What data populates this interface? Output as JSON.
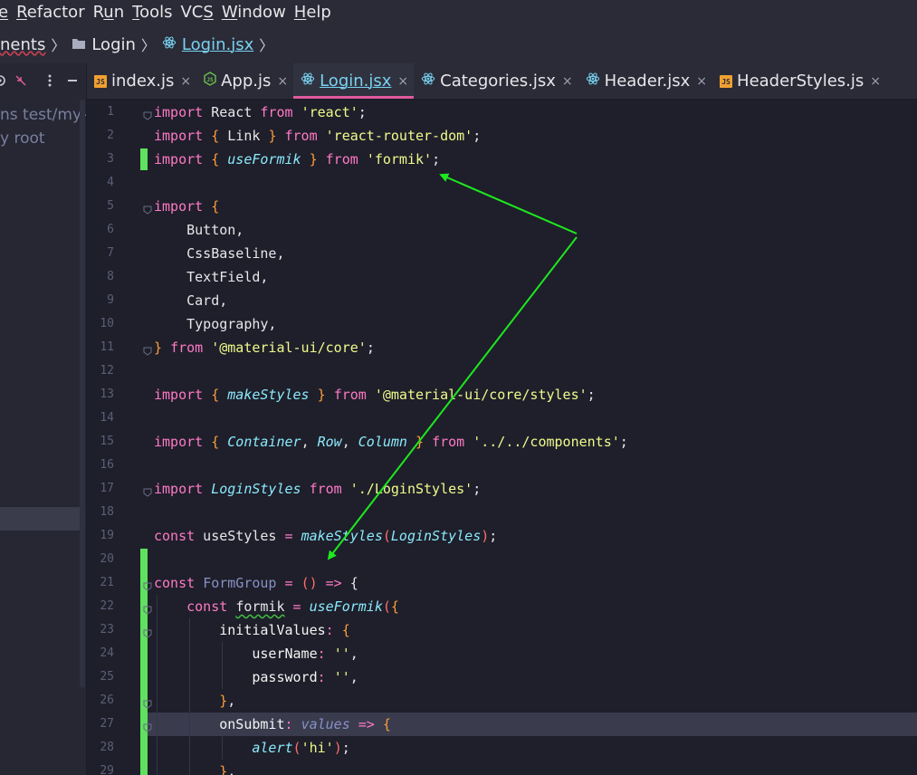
{
  "menubar": {
    "items": [
      {
        "label": "e",
        "mnemonic_index": 0
      },
      {
        "label": "Refactor",
        "mnemonic_index": 0
      },
      {
        "label": "Run",
        "mnemonic_index": 1
      },
      {
        "label": "Tools",
        "mnemonic_index": 0
      },
      {
        "label": "VCS",
        "mnemonic_index": 2
      },
      {
        "label": "Window",
        "mnemonic_index": 0
      },
      {
        "label": "Help",
        "mnemonic_index": 0
      }
    ]
  },
  "breadcrumb": {
    "items": [
      {
        "label": "nents",
        "icon": ""
      },
      {
        "label": "Login",
        "icon": "folder-icon"
      },
      {
        "label": "Login.jsx",
        "icon": "react-icon"
      }
    ]
  },
  "project_panel": {
    "tree": [
      {
        "label": "ns test/my-"
      },
      {
        "label": "y root"
      }
    ]
  },
  "tabs": [
    {
      "label": "index.js",
      "icon": "js-icon",
      "active": false
    },
    {
      "label": "App.js",
      "icon": "node-icon",
      "active": false
    },
    {
      "label": "Login.jsx",
      "icon": "react-icon",
      "active": true
    },
    {
      "label": "Categories.jsx",
      "icon": "react-icon",
      "active": false
    },
    {
      "label": "Header.jsx",
      "icon": "react-icon",
      "active": false
    },
    {
      "label": "HeaderStyles.js",
      "icon": "js-icon",
      "active": false
    }
  ],
  "editor": {
    "current_line": 27,
    "lines": [
      {
        "n": 1,
        "tokens": [
          [
            "kw",
            "import"
          ],
          [
            "punc",
            " React "
          ],
          [
            "kw",
            "from"
          ],
          [
            "punc",
            " "
          ],
          [
            "str",
            "'react'"
          ],
          [
            "punc",
            ";"
          ]
        ]
      },
      {
        "n": 2,
        "tokens": [
          [
            "kw",
            "import"
          ],
          [
            "punc",
            " "
          ],
          [
            "brk",
            "{"
          ],
          [
            "punc",
            " Link "
          ],
          [
            "brk",
            "}"
          ],
          [
            "punc",
            " "
          ],
          [
            "kw",
            "from"
          ],
          [
            "punc",
            " "
          ],
          [
            "str",
            "'react-router-dom'"
          ],
          [
            "punc",
            ";"
          ]
        ]
      },
      {
        "n": 3,
        "tokens": [
          [
            "kw",
            "import"
          ],
          [
            "punc",
            " "
          ],
          [
            "brk",
            "{"
          ],
          [
            "punc",
            " "
          ],
          [
            "ital",
            "useFormik"
          ],
          [
            "punc",
            " "
          ],
          [
            "brk",
            "}"
          ],
          [
            "punc",
            " "
          ],
          [
            "kw",
            "from"
          ],
          [
            "punc",
            " "
          ],
          [
            "str",
            "'formik'"
          ],
          [
            "punc",
            ";"
          ]
        ]
      },
      {
        "n": 4,
        "tokens": []
      },
      {
        "n": 5,
        "tokens": [
          [
            "kw",
            "import"
          ],
          [
            "punc",
            " "
          ],
          [
            "brk",
            "{"
          ]
        ]
      },
      {
        "n": 6,
        "tokens": [
          [
            "punc",
            "    Button,"
          ]
        ]
      },
      {
        "n": 7,
        "tokens": [
          [
            "punc",
            "    CssBaseline,"
          ]
        ]
      },
      {
        "n": 8,
        "tokens": [
          [
            "punc",
            "    TextField,"
          ]
        ]
      },
      {
        "n": 9,
        "tokens": [
          [
            "punc",
            "    Card,"
          ]
        ]
      },
      {
        "n": 10,
        "tokens": [
          [
            "punc",
            "    Typography,"
          ]
        ]
      },
      {
        "n": 11,
        "tokens": [
          [
            "brk",
            "}"
          ],
          [
            "punc",
            " "
          ],
          [
            "kw",
            "from"
          ],
          [
            "punc",
            " "
          ],
          [
            "str",
            "'@material-ui/core'"
          ],
          [
            "punc",
            ";"
          ]
        ]
      },
      {
        "n": 12,
        "tokens": []
      },
      {
        "n": 13,
        "tokens": [
          [
            "kw",
            "import"
          ],
          [
            "punc",
            " "
          ],
          [
            "brk",
            "{"
          ],
          [
            "punc",
            " "
          ],
          [
            "ital",
            "makeStyles"
          ],
          [
            "punc",
            " "
          ],
          [
            "brk",
            "}"
          ],
          [
            "punc",
            " "
          ],
          [
            "kw",
            "from"
          ],
          [
            "punc",
            " "
          ],
          [
            "str",
            "'@material-ui/core/styles'"
          ],
          [
            "punc",
            ";"
          ]
        ]
      },
      {
        "n": 14,
        "tokens": []
      },
      {
        "n": 15,
        "tokens": [
          [
            "kw",
            "import"
          ],
          [
            "punc",
            " "
          ],
          [
            "brk",
            "{"
          ],
          [
            "punc",
            " "
          ],
          [
            "ital",
            "Container"
          ],
          [
            "punc",
            ", "
          ],
          [
            "ital",
            "Row"
          ],
          [
            "punc",
            ", "
          ],
          [
            "ital",
            "Column"
          ],
          [
            "punc",
            " "
          ],
          [
            "brk",
            "}"
          ],
          [
            "punc",
            " "
          ],
          [
            "kw",
            "from"
          ],
          [
            "punc",
            " "
          ],
          [
            "str",
            "'../../components'"
          ],
          [
            "punc",
            ";"
          ]
        ]
      },
      {
        "n": 16,
        "tokens": []
      },
      {
        "n": 17,
        "tokens": [
          [
            "kw",
            "import"
          ],
          [
            "punc",
            " "
          ],
          [
            "ital",
            "LoginStyles"
          ],
          [
            "punc",
            " "
          ],
          [
            "kw",
            "from"
          ],
          [
            "punc",
            " "
          ],
          [
            "str",
            "'./LoginStyles'"
          ],
          [
            "punc",
            ";"
          ]
        ]
      },
      {
        "n": 18,
        "tokens": []
      },
      {
        "n": 19,
        "tokens": [
          [
            "kw",
            "const"
          ],
          [
            "punc",
            " useStyles "
          ],
          [
            "kw",
            "="
          ],
          [
            "punc",
            " "
          ],
          [
            "ital",
            "makeStyles"
          ],
          [
            "paren",
            "("
          ],
          [
            "ital",
            "LoginStyles"
          ],
          [
            "paren",
            ")"
          ],
          [
            "punc",
            ";"
          ]
        ]
      },
      {
        "n": 20,
        "tokens": []
      },
      {
        "n": 21,
        "tokens": [
          [
            "kw",
            "const"
          ],
          [
            "punc",
            " "
          ],
          [
            "fn",
            "FormGroup"
          ],
          [
            "punc",
            " "
          ],
          [
            "kw",
            "="
          ],
          [
            "punc",
            " "
          ],
          [
            "paren",
            "()"
          ],
          [
            "punc",
            " "
          ],
          [
            "kw",
            "=>"
          ],
          [
            "punc",
            " {"
          ]
        ]
      },
      {
        "n": 22,
        "tokens": [
          [
            "punc",
            "    "
          ],
          [
            "kw",
            "const"
          ],
          [
            "punc",
            " "
          ],
          [
            "squig",
            "formik"
          ],
          [
            "punc",
            " "
          ],
          [
            "kw",
            "="
          ],
          [
            "punc",
            " "
          ],
          [
            "ital",
            "useFormik"
          ],
          [
            "paren",
            "("
          ],
          [
            "brk",
            "{"
          ]
        ]
      },
      {
        "n": 23,
        "tokens": [
          [
            "punc",
            "        "
          ],
          [
            "prop",
            "initialValues"
          ],
          [
            "kw",
            ":"
          ],
          [
            "punc",
            " "
          ],
          [
            "brk",
            "{"
          ]
        ]
      },
      {
        "n": 24,
        "tokens": [
          [
            "punc",
            "            "
          ],
          [
            "prop",
            "userName"
          ],
          [
            "kw",
            ":"
          ],
          [
            "punc",
            " "
          ],
          [
            "str",
            "''"
          ],
          [
            "punc",
            ","
          ]
        ]
      },
      {
        "n": 25,
        "tokens": [
          [
            "punc",
            "            "
          ],
          [
            "prop",
            "password"
          ],
          [
            "kw",
            ":"
          ],
          [
            "punc",
            " "
          ],
          [
            "str",
            "''"
          ],
          [
            "punc",
            ","
          ]
        ]
      },
      {
        "n": 26,
        "tokens": [
          [
            "punc",
            "        "
          ],
          [
            "brk",
            "}"
          ],
          [
            "punc",
            ","
          ]
        ]
      },
      {
        "n": 27,
        "tokens": [
          [
            "punc",
            "        "
          ],
          [
            "prop",
            "onSubmit"
          ],
          [
            "kw",
            ":"
          ],
          [
            "punc",
            " "
          ],
          [
            "prm",
            "values"
          ],
          [
            "punc",
            " "
          ],
          [
            "kw",
            "=>"
          ],
          [
            "punc",
            " "
          ],
          [
            "brk",
            "{"
          ]
        ]
      },
      {
        "n": 28,
        "tokens": [
          [
            "punc",
            "            "
          ],
          [
            "ital",
            "alert"
          ],
          [
            "paren",
            "("
          ],
          [
            "str",
            "'hi'"
          ],
          [
            "paren",
            ")"
          ],
          [
            "punc",
            ";"
          ]
        ]
      },
      {
        "n": 29,
        "tokens": [
          [
            "punc",
            "        "
          ],
          [
            "brk",
            "}"
          ],
          [
            "punc",
            ","
          ]
        ]
      }
    ]
  },
  "colors": {
    "accent": "#e05a9c",
    "vcs_added": "#5fe05f",
    "annotation_arrow": "#1ee81e"
  }
}
